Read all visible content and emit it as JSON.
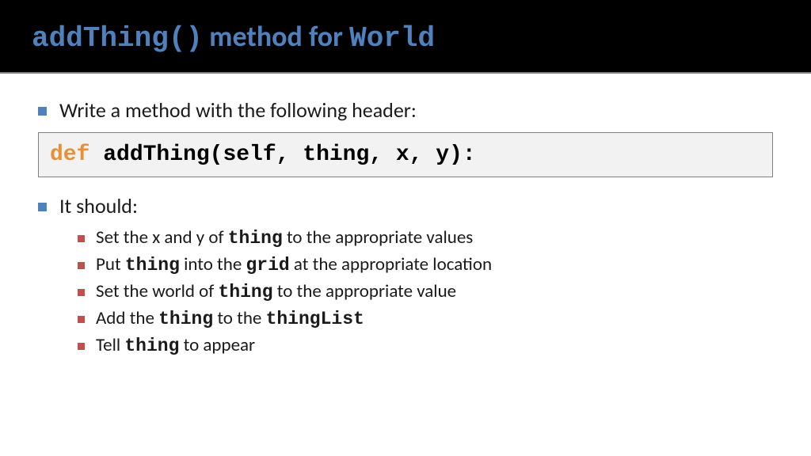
{
  "header": {
    "title_code1": "addThing()",
    "title_mid": " method for ",
    "title_code2": "World"
  },
  "bullet1": "Write a method with the following header:",
  "codebox": {
    "keyword": "def",
    "rest": " addThing(self, thing, x, y):"
  },
  "bullet2": "It should:",
  "sub": [
    {
      "pre": "Set the x and y of ",
      "m1": "thing",
      "post": " to the appropriate values"
    },
    {
      "pre": "Put ",
      "m1": "thing",
      "mid": " into the ",
      "m2": "grid",
      "post": " at the appropriate location"
    },
    {
      "pre": "Set the world of ",
      "m1": "thing",
      "post": " to the appropriate value"
    },
    {
      "pre": "Add the ",
      "m1": "thing",
      "mid": " to the ",
      "m2": "thingList",
      "post": ""
    },
    {
      "pre": "Tell ",
      "m1": "thing",
      "post": " to appear"
    }
  ]
}
